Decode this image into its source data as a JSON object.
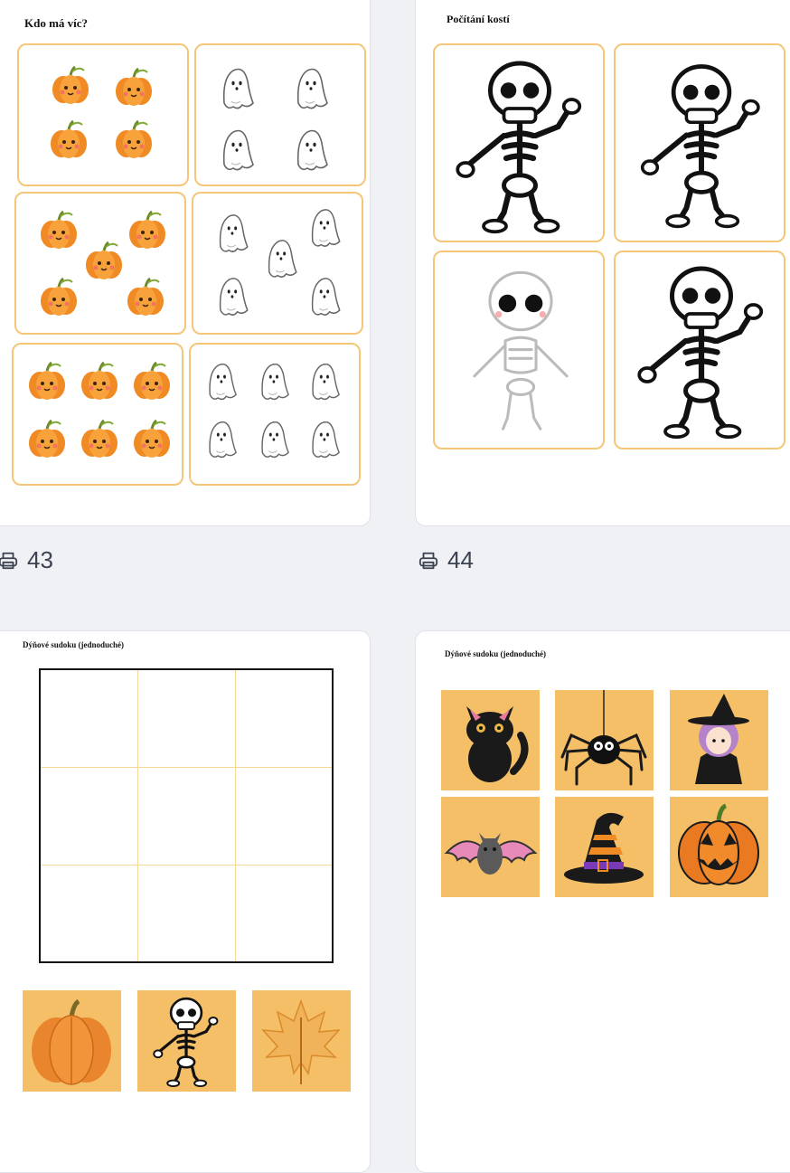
{
  "cards": [
    {
      "title": "Kdo má víc?"
    },
    {
      "title": "Počítání kostí"
    },
    {
      "title": "Dýňové sudoku (jednoduché)"
    },
    {
      "title": "Dýňové sudoku (jednoduché)"
    }
  ],
  "print_counts": [
    {
      "icon": "printer-icon",
      "count": "43"
    },
    {
      "icon": "printer-icon",
      "count": "44"
    }
  ],
  "colors": {
    "page_bg": "#eff1f5",
    "card_bg": "#ffffff",
    "box_border": "#f5c677",
    "tile_bg": "#f4bf67",
    "pumpkin": "#f08a24"
  },
  "compare_rows": [
    {
      "pumpkins": 4,
      "ghosts": 4
    },
    {
      "pumpkins": 5,
      "ghosts": 5
    },
    {
      "pumpkins": 6,
      "ghosts": 6
    }
  ],
  "skeleton_cards": 4,
  "sudoku_pieces": [
    "pumpkin",
    "skeleton",
    "maple-leaf"
  ],
  "halloween_pictures": [
    "black-cat",
    "spider",
    "witch",
    "bat",
    "witch-hat",
    "jack-o-lantern"
  ]
}
